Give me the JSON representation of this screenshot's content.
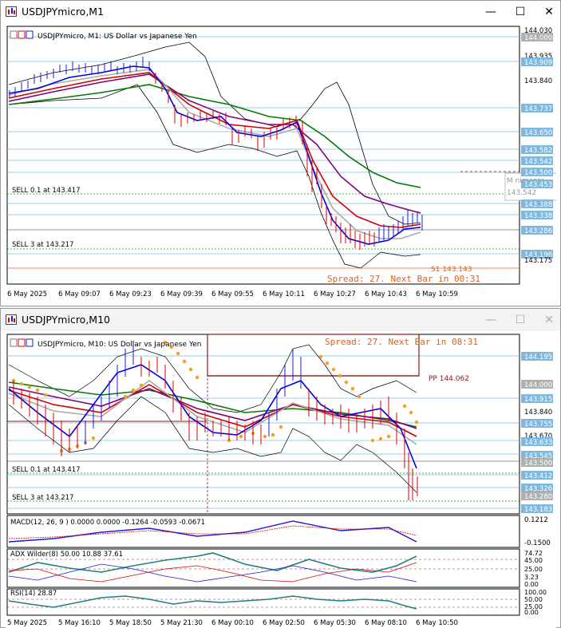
{
  "window1": {
    "title": "USDJPYmicro,M1",
    "chart_title": "USDJPYmicro, M1:  US Dollar vs Japanese Yen",
    "controls": {
      "minimize": "—",
      "maximize": "☐",
      "close": "✕"
    },
    "price_labels": [
      "144.030",
      "144.000",
      "143.935",
      "143.909",
      "143.840",
      "143.737",
      "143.650",
      "143.582",
      "143.542",
      "143.500",
      "143.453",
      "143.388",
      "143.338",
      "143.286",
      "143.196",
      "143.175"
    ],
    "order_lines": [
      "SELL 0.1 at 143.417",
      "SELL 3 at 143.217"
    ],
    "s1_label": "S1 143.143",
    "spread_text": "Spread:  27.  Next Bar in 00:31",
    "overlay_text": "M   nimenta",
    "overlay_price": "143.542",
    "time_labels": [
      "6 May 2025",
      "6 May 09:07",
      "6 May 09:23",
      "6 May 09:39",
      "6 May 09:55",
      "6 May 10:11",
      "6 May 10:27",
      "6 May 10:43",
      "6 May 10:59"
    ]
  },
  "window2": {
    "title": "USDJPYmicro,M10",
    "chart_title": "USDJPYmicro, M10:  US Dollar vs Japanese Yen",
    "controls": {
      "minimize": "—",
      "maximize": "☐",
      "close": "✕"
    },
    "spread_text": "Spread:  27.  Next Bar in 08:31",
    "pp_label": "PP 144.062",
    "price_labels": [
      "144.195",
      "144.000",
      "143.915",
      "143.840",
      "143.755",
      "143.670",
      "143.633",
      "143.545",
      "143.500",
      "143.412",
      "143.326",
      "143.280",
      "143.183"
    ],
    "order_lines": [
      "SELL 0.1 at 143.417",
      "SELL 3 at 143.217"
    ],
    "macd_label": "MACD(12, 26, 9 ) 0.0000  0.0000  -0.1264  -0.0593  -0.0671",
    "macd_scale": [
      "0.1212",
      "-0.1500"
    ],
    "adx_label": "ADX Wilder(8) 50.00  10.88  37.61",
    "adx_scale": [
      "74.72",
      "45.00",
      "25.00",
      "3.23",
      "0.00"
    ],
    "rsi_label": "RSI(14) 28.87",
    "rsi_scale": [
      "100.00",
      "50.00",
      "25.00",
      "0.00"
    ],
    "time_labels": [
      "5 May 2025",
      "5 May 16:10",
      "5 May 18:50",
      "5 May 21:30",
      "6 May 00:10",
      "6 May 02:50",
      "6 May 05:30",
      "6 May 08:10",
      "6 May 10:50"
    ]
  },
  "colors": {
    "bull": "#1a1ad9",
    "bear": "#d90000",
    "grid": "#9ec8e8",
    "ma_red": "#d00000",
    "ma_blue": "#0000e0",
    "ma_purple": "#800080",
    "ma_green": "#007a00",
    "ma_gray": "#b0b0b0",
    "bands": "#000000",
    "accent_orange": "#f2a020"
  }
}
